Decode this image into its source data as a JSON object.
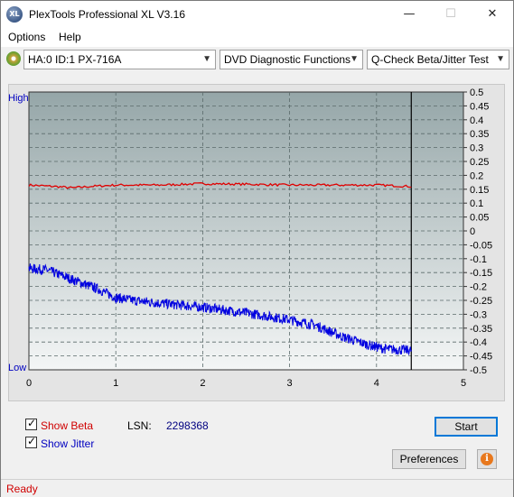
{
  "window": {
    "title": "PlexTools Professional XL V3.16",
    "app_icon_text": "XL",
    "minimize": "—",
    "maximize": "☐",
    "close": "✕"
  },
  "menu": {
    "items": [
      "Options",
      "Help"
    ]
  },
  "toolbar": {
    "drive": "HA:0 ID:1  PX-716A",
    "function": "DVD Diagnostic Functions",
    "test": "Q-Check Beta/Jitter Test"
  },
  "chart_data": {
    "type": "line",
    "x": {
      "min": 0,
      "max": 5,
      "ticks": [
        "0",
        "1",
        "2",
        "3",
        "4",
        "5"
      ]
    },
    "y_right": {
      "min": -0.5,
      "max": 0.5,
      "ticks": [
        "0.5",
        "0.45",
        "0.4",
        "0.35",
        "0.3",
        "0.25",
        "0.2",
        "0.15",
        "0.1",
        "0.05",
        "0",
        "-0.05",
        "-0.1",
        "-0.15",
        "-0.2",
        "-0.25",
        "-0.3",
        "-0.35",
        "-0.4",
        "-0.45",
        "-0.5"
      ]
    },
    "y_left_labels": {
      "high": "High",
      "low": "Low"
    },
    "end_marker_x": 4.4,
    "series": [
      {
        "color": "#e00000",
        "x": [
          0,
          0.3,
          0.5,
          0.7,
          1.0,
          1.5,
          2.0,
          2.5,
          3.0,
          3.5,
          4.0,
          4.4
        ],
        "values": [
          0.165,
          0.16,
          0.155,
          0.16,
          0.165,
          0.165,
          0.17,
          0.168,
          0.165,
          0.165,
          0.165,
          0.16
        ]
      },
      {
        "color": "#0000e0",
        "x": [
          0,
          0.2,
          0.5,
          0.8,
          1.0,
          1.2,
          1.5,
          2.0,
          2.5,
          3.0,
          3.3,
          3.6,
          3.9,
          4.1,
          4.4
        ],
        "values": [
          -0.135,
          -0.14,
          -0.175,
          -0.21,
          -0.24,
          -0.25,
          -0.26,
          -0.275,
          -0.295,
          -0.32,
          -0.34,
          -0.38,
          -0.41,
          -0.425,
          -0.43
        ]
      }
    ]
  },
  "controls": {
    "show_beta": "Show Beta",
    "show_jitter": "Show Jitter",
    "checkmark": "✓",
    "lsn_label": "LSN:",
    "lsn_value": "2298368",
    "start": "Start",
    "preferences": "Preferences",
    "info": "i"
  },
  "status": {
    "text": "Ready"
  }
}
